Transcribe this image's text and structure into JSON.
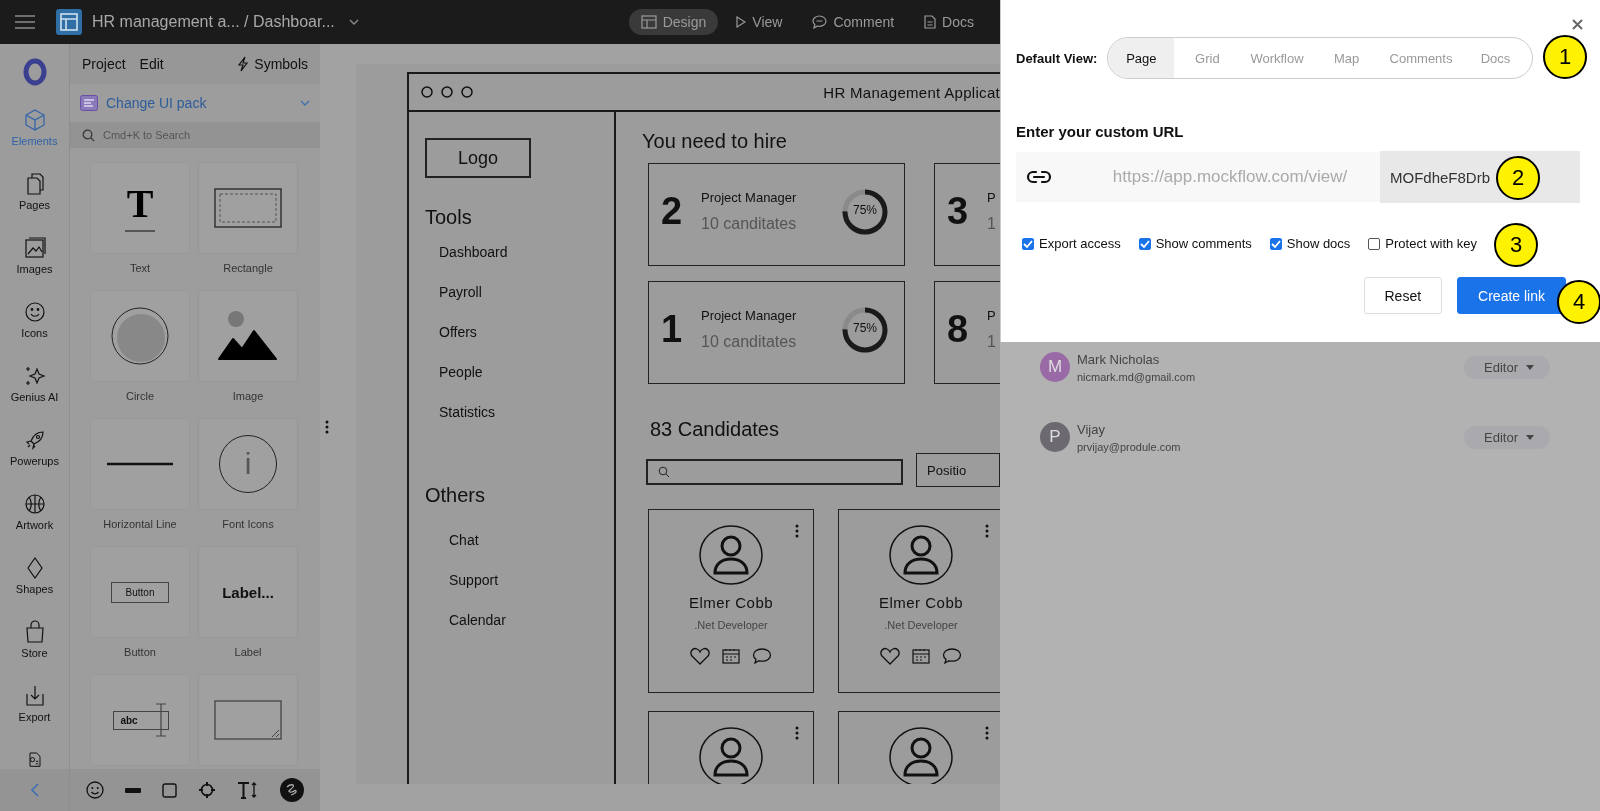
{
  "topbar": {
    "title": "HR management a... / Dashboar...",
    "modes": [
      {
        "kind": "design",
        "label": "Design",
        "selected": true
      },
      {
        "kind": "view",
        "label": "View",
        "selected": false
      },
      {
        "kind": "comment",
        "label": "Comment",
        "selected": false
      },
      {
        "kind": "docs",
        "label": "Docs",
        "selected": false
      }
    ]
  },
  "rail": {
    "items": [
      {
        "kind": "elements",
        "label": "Elements",
        "selected": true
      },
      {
        "kind": "pages",
        "label": "Pages",
        "selected": false
      },
      {
        "kind": "images",
        "label": "Images",
        "selected": false
      },
      {
        "kind": "icons",
        "label": "Icons",
        "selected": false
      },
      {
        "kind": "ai",
        "label": "Genius AI",
        "selected": false
      },
      {
        "kind": "powerups",
        "label": "Powerups",
        "selected": false
      },
      {
        "kind": "artwork",
        "label": "Artwork",
        "selected": false
      },
      {
        "kind": "shapes",
        "label": "Shapes",
        "selected": false
      },
      {
        "kind": "store",
        "label": "Store",
        "selected": false
      },
      {
        "kind": "export",
        "label": "Export",
        "selected": false
      },
      {
        "kind": "template",
        "selected": false
      }
    ]
  },
  "panel": {
    "menu": [
      "Project",
      "Edit"
    ],
    "symbols": "Symbols",
    "ui_pack": "Change UI pack",
    "search": {
      "placeholder": "Cmd+K to Search"
    },
    "elements": [
      {
        "kind": "text",
        "label": "Text",
        "preview": "T"
      },
      {
        "kind": "rectangle",
        "label": "Rectangle"
      },
      {
        "kind": "circle",
        "label": "Circle"
      },
      {
        "kind": "image",
        "label": "Image"
      },
      {
        "kind": "line",
        "label": "Horizontal Line"
      },
      {
        "kind": "font_icons",
        "label": "Font Icons",
        "preview": "i"
      },
      {
        "kind": "button",
        "label": "Button",
        "preview": "Button"
      },
      {
        "kind": "label",
        "label": "Label",
        "preview": "Label..."
      },
      {
        "kind": "input",
        "preview": "abc"
      },
      {
        "kind": "textarea"
      }
    ]
  },
  "wireframe": {
    "title": "HR Management Applicat",
    "logo": "Logo",
    "nav_sections": [
      {
        "heading": "Tools",
        "items": [
          "Dashboard",
          "Payroll",
          "Offers",
          "People",
          "Statistics"
        ]
      },
      {
        "heading": "Others",
        "items": [
          "Chat",
          "Support",
          "Calendar"
        ]
      }
    ],
    "hire_heading": "You need to hire",
    "hire_cards": [
      {
        "count": "2",
        "role": "Project Manager",
        "candidates": "10 canditates",
        "percent": "75%",
        "level": 0.75
      },
      {
        "count": "3",
        "role": "P",
        "candidates": "1"
      },
      {
        "count": "1",
        "role": "Project Manager",
        "candidates": "10 canditates",
        "percent": "75%",
        "level": 0.75
      },
      {
        "count": "8",
        "role": "P",
        "candidates": "1"
      }
    ],
    "candidates_heading": "83 Candidates",
    "filter_button": "Positio",
    "candidate_cards": [
      {
        "kind": "full",
        "name": "Elmer Cobb",
        "role": ".Net Developer"
      },
      {
        "kind": "full",
        "name": "Elmer Cobb",
        "role": ".Net Developer"
      },
      {
        "kind": "cut"
      },
      {
        "kind": "cut"
      }
    ]
  },
  "dialog": {
    "default_view_label": "Default View:",
    "views": [
      {
        "label": "Page",
        "selected": true
      },
      {
        "label": "Grid",
        "selected": false
      },
      {
        "label": "Workflow",
        "selected": false
      },
      {
        "label": "Map",
        "selected": false
      },
      {
        "label": "Comments",
        "selected": false
      },
      {
        "label": "Docs",
        "selected": false
      }
    ],
    "url_label": "Enter your custom URL",
    "url_prefix": "https://app.mockflow.com/view/",
    "url_slug": "MOFdheF8Drb",
    "options": [
      {
        "label": "Export access",
        "checked": true
      },
      {
        "label": "Show comments",
        "checked": true
      },
      {
        "label": "Show docs",
        "checked": true
      },
      {
        "label": "Protect with key",
        "checked": false
      }
    ],
    "buttons": [
      {
        "kind": "secondary",
        "label": "Reset"
      },
      {
        "kind": "primary",
        "label": "Create link"
      }
    ]
  },
  "callouts": [
    "1",
    "2",
    "3",
    "4"
  ],
  "share_list": [
    {
      "initial": "M",
      "name": "Mark Nicholas",
      "email": "nicmark.md@gmail.com",
      "role": "Editor",
      "color": "#9a6aa6"
    },
    {
      "initial": "P",
      "name": "Vijay",
      "email": "prvijay@produle.com",
      "role": "Editor",
      "color": "#6c6a70"
    }
  ]
}
